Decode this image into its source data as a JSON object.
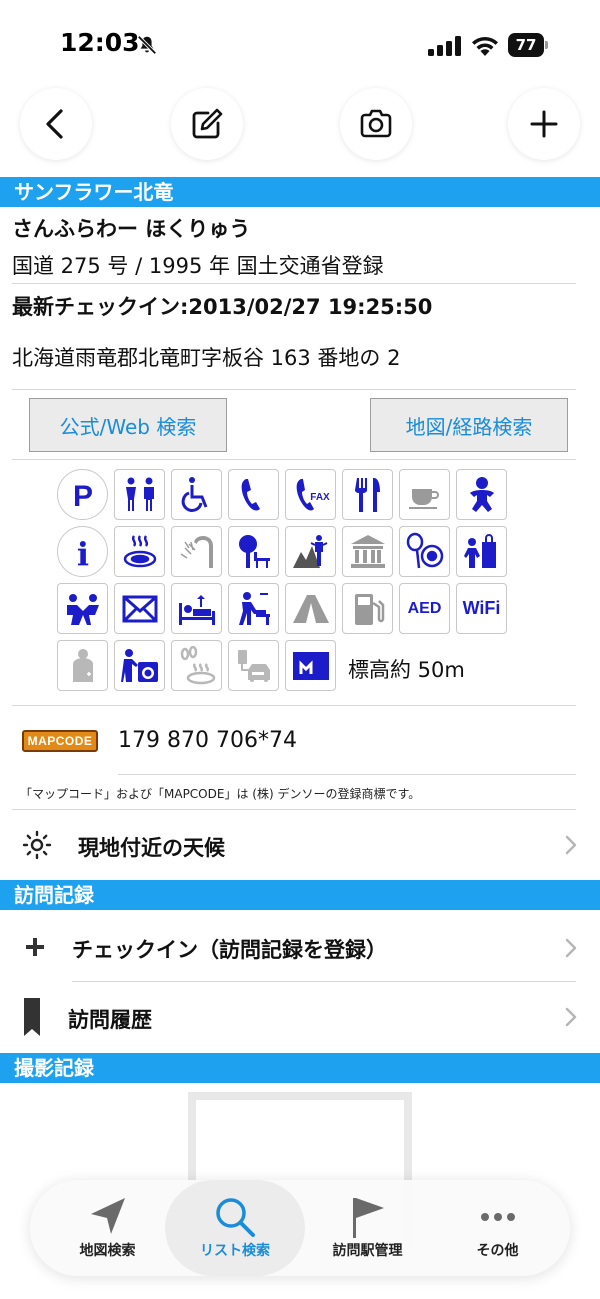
{
  "status": {
    "time": "12:03",
    "battery": "77"
  },
  "toolbar": {
    "back": "back-icon",
    "edit": "edit-icon",
    "camera": "camera-icon",
    "add": "plus-icon"
  },
  "station": {
    "name": "サンフラワー北竜",
    "reading": "さんふらわー ほくりゅう",
    "route_info": "国道 275 号 / 1995 年 国土交通省登録",
    "last_checkin": "最新チェックイン:2013/02/27 19:25:50",
    "address": "北海道雨竜郡北竜町字板谷 163 番地の 2"
  },
  "buttons": {
    "web_search": "公式/Web 検索",
    "map_search": "地図/経路検索"
  },
  "facilities": {
    "aed_label": "AED",
    "wifi_label": "WiFi",
    "fax_label": "FAX",
    "elevation": "標高約 50m"
  },
  "mapcode": {
    "logo": "MAPCODE",
    "value": "179 870 706*74",
    "note": "「マップコード」および「MAPCODE」は (株) デンソーの登録商標です。"
  },
  "weather": {
    "label": "現地付近の天候"
  },
  "visit_section": {
    "title": "訪問記録",
    "checkin": "チェックイン（訪問記録を登録）",
    "history": "訪問履歴"
  },
  "photo_section": {
    "title": "撮影記録"
  },
  "tabs": [
    {
      "label": "地図検索",
      "icon": "location-arrow-icon",
      "active": false
    },
    {
      "label": "リスト検索",
      "icon": "search-icon",
      "active": true
    },
    {
      "label": "訪問駅管理",
      "icon": "flag-icon",
      "active": false
    },
    {
      "label": "その他",
      "icon": "more-icon",
      "active": false
    }
  ],
  "colors": {
    "accent": "#1ea1ef",
    "icon_blue": "#1c1cc8",
    "icon_gray": "#9a9a9a",
    "link": "#1a8cd8"
  }
}
